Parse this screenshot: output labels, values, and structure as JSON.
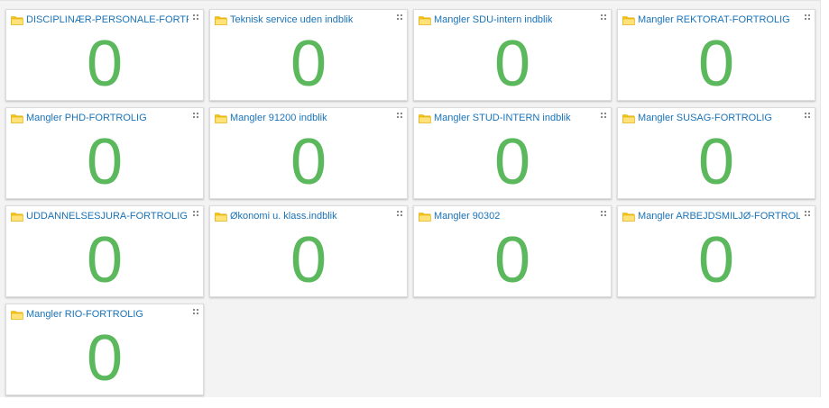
{
  "colors": {
    "title_link": "#1a73b8",
    "count": "#5cb85c",
    "folder_body": "#f5c516",
    "folder_front": "#ffe27a"
  },
  "tiles": [
    {
      "title": "DISCIPLINÆR-PERSONALE-FORTR",
      "count": "0",
      "icon": "folder-icon"
    },
    {
      "title": "Teknisk service uden indblik",
      "count": "0",
      "icon": "folder-icon"
    },
    {
      "title": "Mangler SDU-intern indblik",
      "count": "0",
      "icon": "folder-icon"
    },
    {
      "title": "Mangler REKTORAT-FORTROLIG",
      "count": "0",
      "icon": "folder-icon"
    },
    {
      "title": "Mangler PHD-FORTROLIG",
      "count": "0",
      "icon": "folder-icon"
    },
    {
      "title": "Mangler 91200 indblik",
      "count": "0",
      "icon": "folder-icon"
    },
    {
      "title": "Mangler STUD-INTERN indblik",
      "count": "0",
      "icon": "folder-icon"
    },
    {
      "title": "Mangler SUSAG-FORTROLIG",
      "count": "0",
      "icon": "folder-icon"
    },
    {
      "title": "UDDANNELSESJURA-FORTROLIG",
      "count": "0",
      "icon": "folder-icon"
    },
    {
      "title": "Økonomi u. klass.indblik",
      "count": "0",
      "icon": "folder-icon"
    },
    {
      "title": "Mangler 90302",
      "count": "0",
      "icon": "folder-icon"
    },
    {
      "title": "Mangler ARBEJDSMILJØ-FORTROLIG",
      "count": "0",
      "icon": "folder-icon"
    },
    {
      "title": "Mangler RIO-FORTROLIG",
      "count": "0",
      "icon": "folder-icon"
    }
  ]
}
